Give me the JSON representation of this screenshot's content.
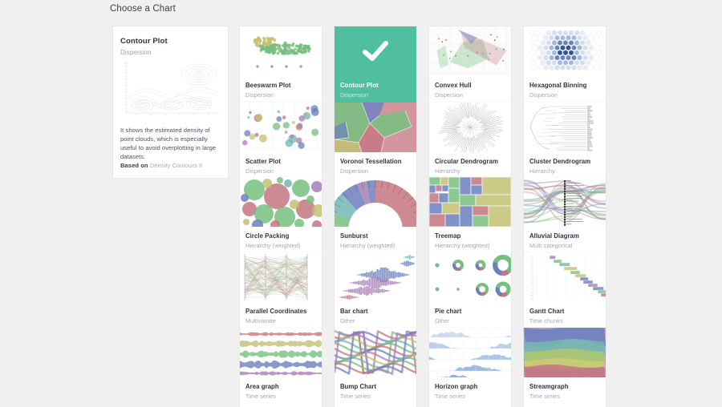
{
  "header": {
    "title": "Choose a Chart"
  },
  "colors": {
    "background": "#f0f0f0",
    "card_bg": "#ffffff",
    "selected_green": "#4fbf9f",
    "title_text": "#2e3440",
    "sub_text": "#a2a8ae"
  },
  "detail": {
    "title": "Contour Plot",
    "subtitle": "Dispersion",
    "description": "It shows the estimated density of point clouds, which is especially useful to avoid overplotting in large datasets.",
    "based_on_label": "Based on",
    "based_on_source": "Density Contours II",
    "thumb_icon": "contour-plot-thumbnail"
  },
  "grid": {
    "selected_index": 1,
    "cards": [
      {
        "title": "Beeswarm Plot",
        "subtitle": "Dispersion",
        "thumb": "beeswarm-thumbnail",
        "selected": false
      },
      {
        "title": "Contour Plot",
        "subtitle": "Dispersion",
        "thumb": "check-icon",
        "selected": true
      },
      {
        "title": "Convex Hull",
        "subtitle": "Dispersion",
        "thumb": "convex-hull-thumbnail",
        "selected": false
      },
      {
        "title": "Hexagonal Binning",
        "subtitle": "Dispersion",
        "thumb": "hexbin-thumbnail",
        "selected": false
      },
      {
        "title": "Scatter Plot",
        "subtitle": "Dispersion",
        "thumb": "scatter-thumbnail",
        "selected": false
      },
      {
        "title": "Voronoi Tessellation",
        "subtitle": "Dispersion",
        "thumb": "voronoi-thumbnail",
        "selected": false
      },
      {
        "title": "Circular Dendrogram",
        "subtitle": "Hierarchy",
        "thumb": "circular-dendrogram-thumbnail",
        "selected": false
      },
      {
        "title": "Cluster Dendrogram",
        "subtitle": "Hierarchy",
        "thumb": "cluster-dendrogram-thumbnail",
        "selected": false
      },
      {
        "title": "Circle Packing",
        "subtitle": "Hierarchy (weighted)",
        "thumb": "circle-packing-thumbnail",
        "selected": false
      },
      {
        "title": "Sunburst",
        "subtitle": "Hierarchy (weighted)",
        "thumb": "sunburst-thumbnail",
        "selected": false
      },
      {
        "title": "Treemap",
        "subtitle": "Hierarchy (weighted)",
        "thumb": "treemap-thumbnail",
        "selected": false
      },
      {
        "title": "Alluvial Diagram",
        "subtitle": "Multi categorical",
        "thumb": "alluvial-thumbnail",
        "selected": false
      },
      {
        "title": "Parallel Coordinates",
        "subtitle": "Multivariate",
        "thumb": "parallel-coordinates-thumbnail",
        "selected": false
      },
      {
        "title": "Bar chart",
        "subtitle": "Other",
        "thumb": "bar-chart-thumbnail",
        "selected": false
      },
      {
        "title": "Pie chart",
        "subtitle": "Other",
        "thumb": "pie-chart-thumbnail",
        "selected": false
      },
      {
        "title": "Gantt Chart",
        "subtitle": "Time chunks",
        "thumb": "gantt-thumbnail",
        "selected": false
      },
      {
        "title": "Area graph",
        "subtitle": "Time series",
        "thumb": "area-graph-thumbnail",
        "selected": false
      },
      {
        "title": "Bump Chart",
        "subtitle": "Time series",
        "thumb": "bump-chart-thumbnail",
        "selected": false
      },
      {
        "title": "Horizon graph",
        "subtitle": "Time series",
        "thumb": "horizon-graph-thumbnail",
        "selected": false
      },
      {
        "title": "Streamgraph",
        "subtitle": "Time series",
        "thumb": "streamgraph-thumbnail",
        "selected": false
      }
    ]
  }
}
